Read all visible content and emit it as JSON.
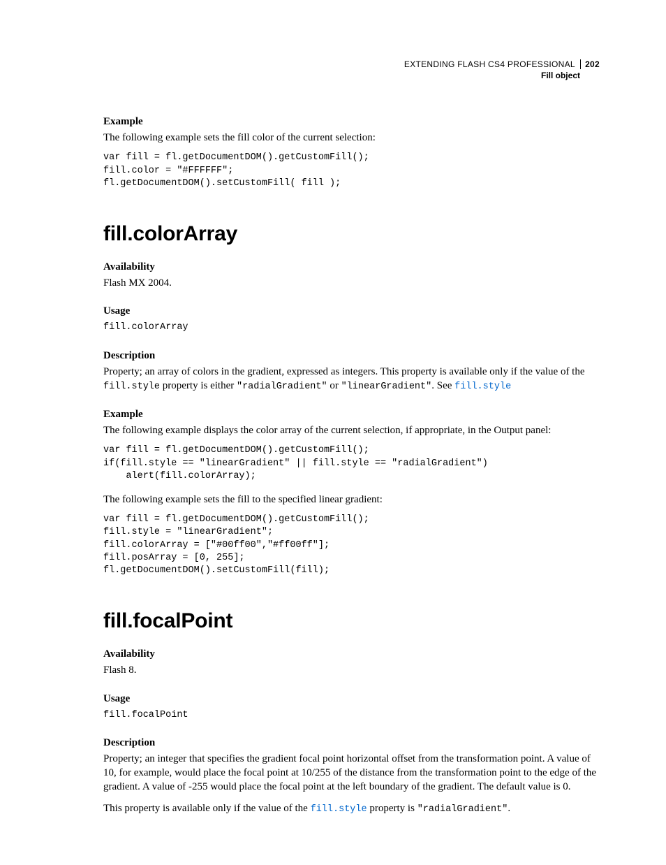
{
  "header": {
    "doc_title": "EXTENDING FLASH CS4 PROFESSIONAL",
    "page_number": "202",
    "section": "Fill object"
  },
  "block0": {
    "heading": "Example",
    "intro": "The following example sets the fill color of the current selection:",
    "code": "var fill = fl.getDocumentDOM().getCustomFill();\nfill.color = \"#FFFFFF\";\nfl.getDocumentDOM().setCustomFill( fill );"
  },
  "section1": {
    "title": "fill.colorArray",
    "avail_h": "Availability",
    "avail_t": "Flash MX 2004.",
    "usage_h": "Usage",
    "usage_code": "fill.colorArray",
    "desc_h": "Description",
    "desc_t1": "Property; an array of colors in the gradient, expressed as integers. This property is available only if the value of the ",
    "desc_code1": "fill.style",
    "desc_t2": " property is either ",
    "desc_code2": "\"radialGradient\"",
    "desc_t3": " or ",
    "desc_code3": "\"linearGradient\"",
    "desc_t4": ". See ",
    "desc_link": "fill.style",
    "ex_h": "Example",
    "ex_intro1": "The following example displays the color array of the current selection, if appropriate, in the Output panel:",
    "ex_code1": "var fill = fl.getDocumentDOM().getCustomFill();\nif(fill.style == \"linearGradient\" || fill.style == \"radialGradient\")\n    alert(fill.colorArray);",
    "ex_intro2": "The following example sets the fill to the specified linear gradient:",
    "ex_code2": "var fill = fl.getDocumentDOM().getCustomFill();\nfill.style = \"linearGradient\";\nfill.colorArray = [\"#00ff00\",\"#ff00ff\"];\nfill.posArray = [0, 255];\nfl.getDocumentDOM().setCustomFill(fill);"
  },
  "section2": {
    "title": "fill.focalPoint",
    "avail_h": "Availability",
    "avail_t": "Flash 8.",
    "usage_h": "Usage",
    "usage_code": "fill.focalPoint",
    "desc_h": "Description",
    "desc_t": "Property; an integer that specifies the gradient focal point horizontal offset from the transformation point. A value of 10, for example, would place the focal point at 10/255 of the distance from the transformation point to the edge of the gradient. A value of -255 would place the focal point at the left boundary of the gradient. The default value is 0.",
    "desc2_t1": "This property is available only if the value of the ",
    "desc2_link": "fill.style",
    "desc2_t2": " property is ",
    "desc2_code": "\"radialGradient\"",
    "desc2_t3": "."
  }
}
